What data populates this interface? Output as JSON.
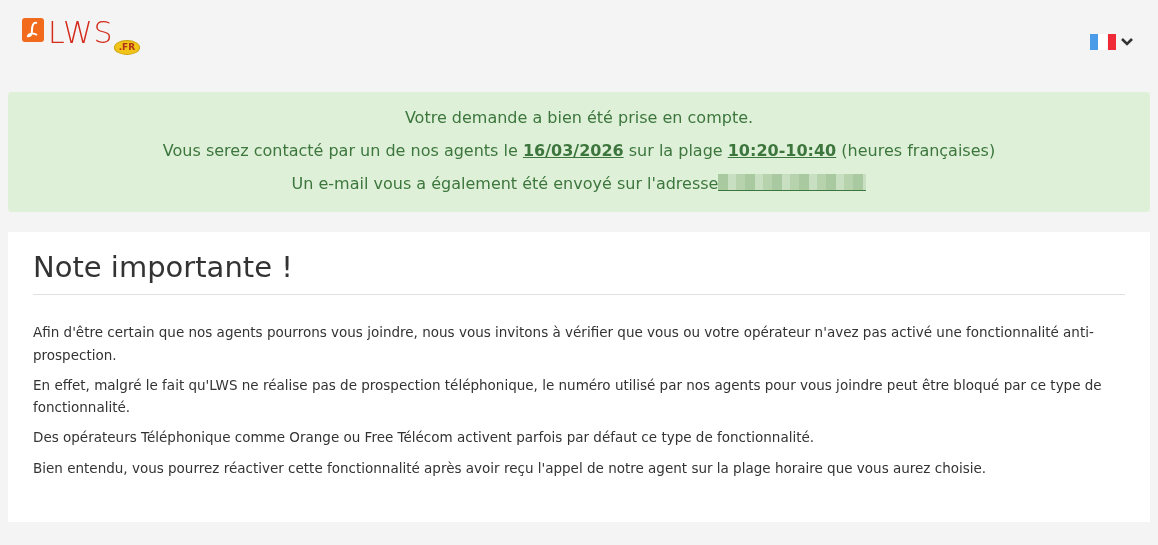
{
  "header": {
    "logo": {
      "text": "LWS",
      "badge": ".FR"
    },
    "language_menu": {
      "expanded": false
    }
  },
  "confirmation": {
    "lines": [
      "Votre demande a bien été prise en compte.",
      "Vous serez contacté par un de nos agents le **16/03/2026** sur la plage **10:20-10:40** (heures françaises)",
      "Un e-mail vous a également été envoyé sur l'adresse"
    ],
    "email_redacted": true
  },
  "note": {
    "title": "Note importante !",
    "paragraphs": [
      "Afin d'être certain que nos agents pourrons vous joindre, nous vous invitons à vérifier que vous ou votre opérateur n'avez pas activé une fonctionnalité anti-prospection.",
      "En effet, malgré le fait qu'LWS ne réalise pas de prospection téléphonique, le numéro utilisé par nos agents pour vous joindre peut être bloqué par ce type de fonctionnalité.",
      "Des opérateurs Téléphonique comme Orange ou Free Télécom activent parfois par défaut ce type de fonctionnalité.",
      "Bien entendu, vous pourrez réactiver cette fonctionnalité après avoir reçu l'appel de notre agent sur la plage horaire que vous aurez choisie."
    ]
  }
}
